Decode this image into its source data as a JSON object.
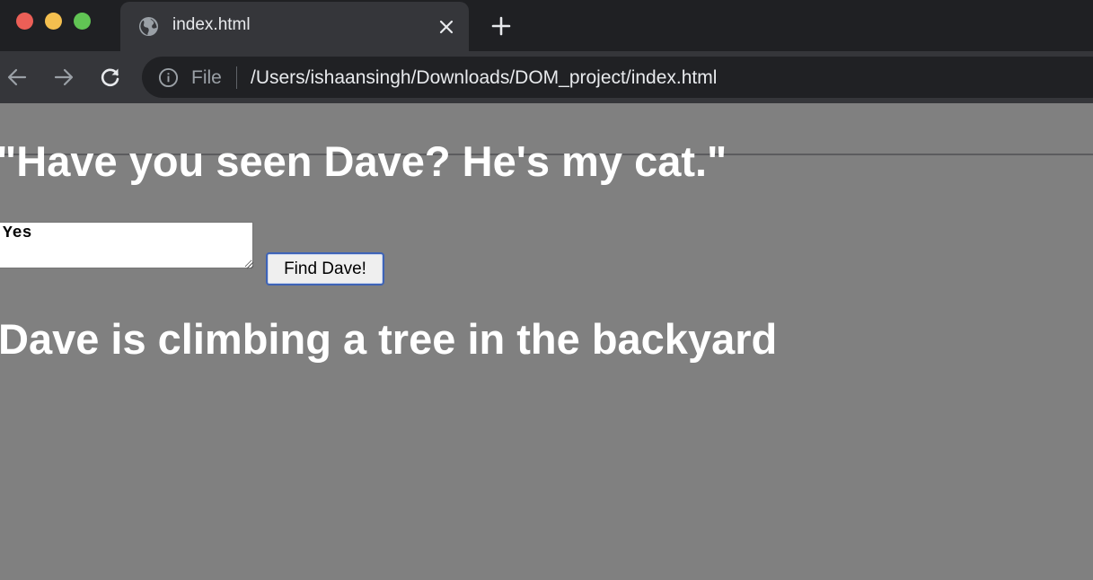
{
  "browser": {
    "tab": {
      "title": "index.html"
    },
    "omnibox": {
      "scheme_label": "File",
      "url": "/Users/ishaansingh/Downloads/DOM_project/index.html"
    },
    "icons": {
      "tab": "globe-icon",
      "tab_close": "close-icon",
      "new_tab": "plus-icon",
      "back": "arrow-left-icon",
      "forward": "arrow-right-icon",
      "reload": "reload-icon",
      "site_info": "info-icon"
    },
    "colors": {
      "tabstrip_bg": "#1f2023",
      "toolbar_bg": "#35363a",
      "omnibox_bg": "#202124",
      "traffic_close": "#ec5f57",
      "traffic_minimize": "#f4bf4f",
      "traffic_maximize": "#61c454"
    }
  },
  "page": {
    "headline": "\"Have you seen Dave? He's my cat.\"",
    "answer_value": "Yes",
    "find_button_label": "Find Dave!",
    "result": "Dave is climbing a tree in the backyard",
    "colors": {
      "background": "#808080",
      "text": "#ffffff",
      "button_focus": "#3e63b6"
    }
  }
}
